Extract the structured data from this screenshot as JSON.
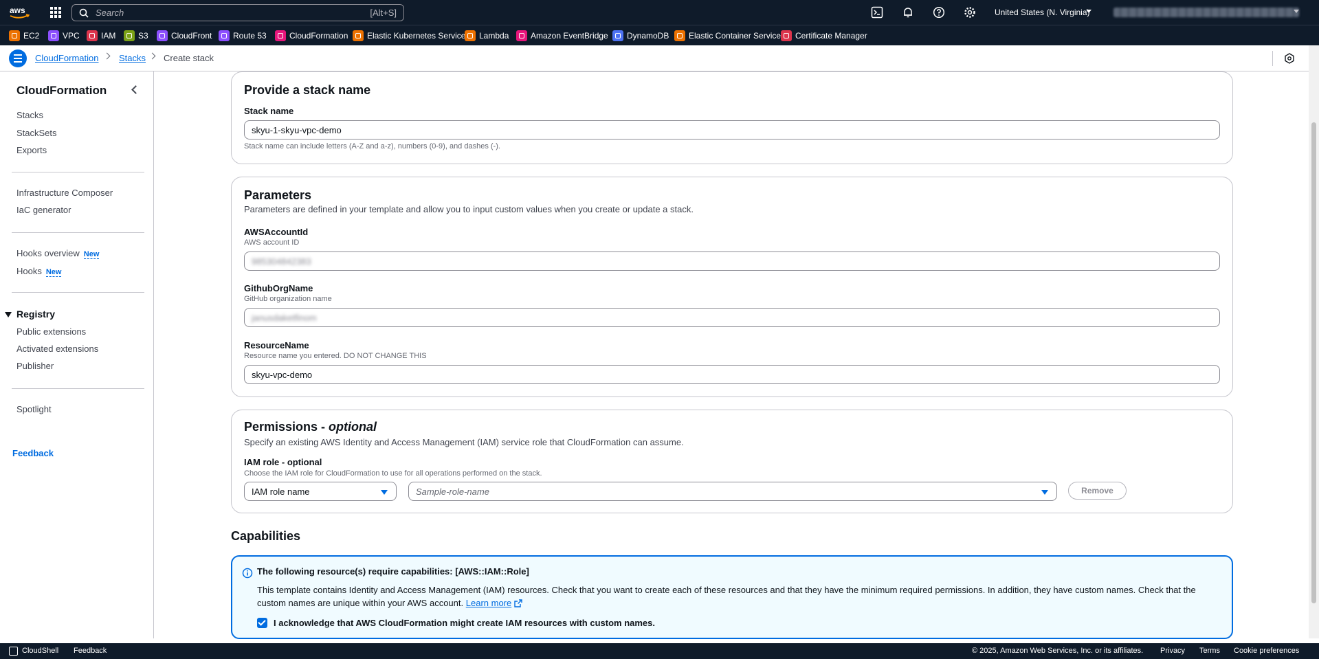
{
  "topnav": {
    "search_placeholder": "Search",
    "search_shortcut": "[Alt+S]",
    "region": "United States (N. Virginia)"
  },
  "favorites": [
    {
      "label": "EC2",
      "color": "#ed7100"
    },
    {
      "label": "VPC",
      "color": "#8c4fff"
    },
    {
      "label": "IAM",
      "color": "#dd344c"
    },
    {
      "label": "S3",
      "color": "#7aa116"
    },
    {
      "label": "CloudFront",
      "color": "#8c4fff"
    },
    {
      "label": "Route 53",
      "color": "#8c4fff"
    },
    {
      "label": "CloudFormation",
      "color": "#e7157b"
    },
    {
      "label": "Elastic Kubernetes Service",
      "color": "#ed7100"
    },
    {
      "label": "Lambda",
      "color": "#ed7100"
    },
    {
      "label": "Amazon EventBridge",
      "color": "#e7157b"
    },
    {
      "label": "DynamoDB",
      "color": "#4d72f3"
    },
    {
      "label": "Elastic Container Service",
      "color": "#ed7100"
    },
    {
      "label": "Certificate Manager",
      "color": "#dd344c"
    }
  ],
  "breadcrumb": {
    "root": "CloudFormation",
    "stacks": "Stacks",
    "current": "Create stack"
  },
  "sidenav": {
    "title": "CloudFormation",
    "items_main": [
      "Stacks",
      "StackSets",
      "Exports"
    ],
    "items_tools": [
      "Infrastructure Composer",
      "IaC generator"
    ],
    "hooks_overview": "Hooks overview",
    "hooks": "Hooks",
    "new_badge": "New",
    "registry": "Registry",
    "registry_items": [
      "Public extensions",
      "Activated extensions",
      "Publisher"
    ],
    "spotlight": "Spotlight",
    "feedback": "Feedback"
  },
  "stack_name": {
    "heading": "Provide a stack name",
    "label": "Stack name",
    "value": "skyu-1-skyu-vpc-demo",
    "hint": "Stack name can include letters (A-Z and a-z), numbers (0-9), and dashes (-)."
  },
  "parameters": {
    "heading": "Parameters",
    "description": "Parameters are defined in your template and allow you to input custom values when you create or update a stack.",
    "fields": [
      {
        "label": "AWSAccountId",
        "desc": "AWS account ID",
        "value": "985304842383"
      },
      {
        "label": "GithubOrgName",
        "desc": "GitHub organization name",
        "value": "janusdaketfinom"
      },
      {
        "label": "ResourceName",
        "desc": "Resource name you entered. DO NOT CHANGE THIS",
        "value": "skyu-vpc-demo"
      }
    ]
  },
  "permissions": {
    "heading_main": "Permissions - ",
    "heading_optional": "optional",
    "description": "Specify an existing AWS Identity and Access Management (IAM) service role that CloudFormation can assume.",
    "role_label": "IAM role - optional",
    "role_desc": "Choose the IAM role for CloudFormation to use for all operations performed on the stack.",
    "role_type": "IAM role name",
    "role_placeholder": "Sample-role-name",
    "remove": "Remove"
  },
  "capabilities": {
    "heading": "Capabilities",
    "alert_title": "The following resource(s) require capabilities: [AWS::IAM::Role]",
    "alert_body": "This template contains Identity and Access Management (IAM) resources. Check that you want to create each of these resources and that they have the minimum required permissions. In addition, they have custom names. Check that the custom names are unique within your AWS account.",
    "learn_more": "Learn more",
    "acknowledge": "I acknowledge that AWS CloudFormation might create IAM resources with custom names."
  },
  "footer": {
    "cloudshell": "CloudShell",
    "feedback": "Feedback",
    "copyright": "© 2025, Amazon Web Services, Inc. or its affiliates.",
    "privacy": "Privacy",
    "terms": "Terms",
    "cookies": "Cookie preferences"
  }
}
